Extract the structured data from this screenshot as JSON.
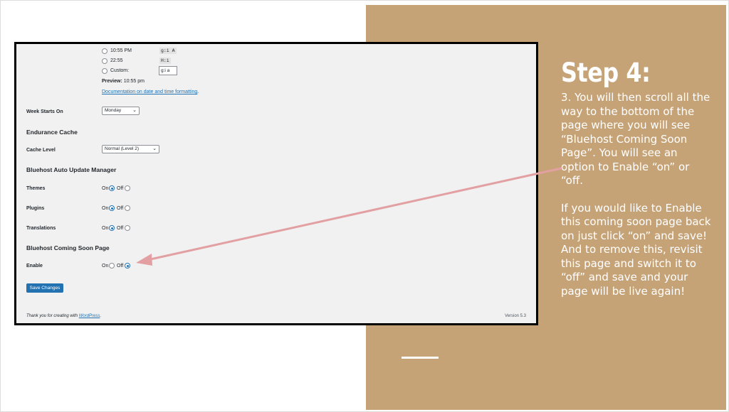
{
  "colors": {
    "panel": "#c6a377",
    "arrow": "#e3a0a2",
    "accent": "#2271b1"
  },
  "slide": {
    "title": "Step 4:",
    "paragraph1": "3. You will then scroll all the way to the bottom of the page where you will see “Bluehost Coming Soon Page”. You will see an option to Enable “on” or “off.",
    "paragraph2": "If you would like to Enable this coming soon page back on just click “on” and save! And to remove this, revisit this page and switch it to “off” and save and your page will be live again!"
  },
  "settings": {
    "time_options": [
      {
        "label": "10:55 PM",
        "code": "g:i A"
      },
      {
        "label": "22:55",
        "code": "H:i"
      },
      {
        "label": "Custom:",
        "code": "g:i a"
      }
    ],
    "preview_label": "Preview:",
    "preview_value": "10:55 pm",
    "doc_link": "Documentation on date and time formatting",
    "doc_link_suffix": ".",
    "week_starts_label": "Week Starts On",
    "week_starts_value": "Monday",
    "endurance_heading": "Endurance Cache",
    "cache_level_label": "Cache Level",
    "cache_level_value": "Normal (Level 2)",
    "update_heading": "Bluehost Auto Update Manager",
    "on_label": "On",
    "off_label": "Off",
    "themes_label": "Themes",
    "plugins_label": "Plugins",
    "translations_label": "Translations",
    "coming_soon_heading": "Bluehost Coming Soon Page",
    "enable_label": "Enable",
    "save_label": "Save Changes",
    "footer_prefix": "Thank you for creating with ",
    "footer_link": "WordPress",
    "footer_suffix": ".",
    "version": "Version 5.3"
  }
}
